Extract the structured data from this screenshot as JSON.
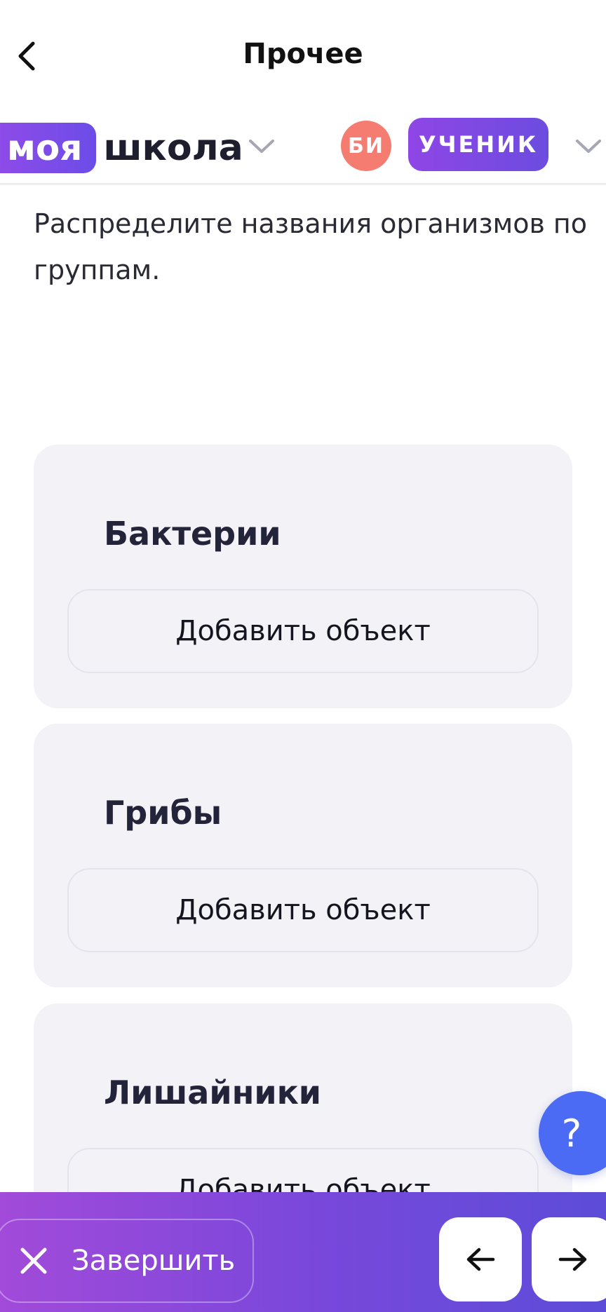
{
  "topbar": {
    "title": "Прочее"
  },
  "brand": {
    "part1": "моя",
    "part2": "школа"
  },
  "user": {
    "initials": "БИ",
    "role": "УЧЕНИК"
  },
  "task": {
    "text": "Распределите названия организмов по группам."
  },
  "groups": [
    {
      "title": "Бактерии",
      "add_label": "Добавить объект"
    },
    {
      "title": "Грибы",
      "add_label": "Добавить объект"
    },
    {
      "title": "Лишайники",
      "add_label": "Добавить объект"
    }
  ],
  "help": {
    "label": "?"
  },
  "footer": {
    "finish_label": "Завершить"
  },
  "colors": {
    "accent": "#7a48db",
    "help": "#4b6bf5",
    "avatar": "#f57c70"
  }
}
